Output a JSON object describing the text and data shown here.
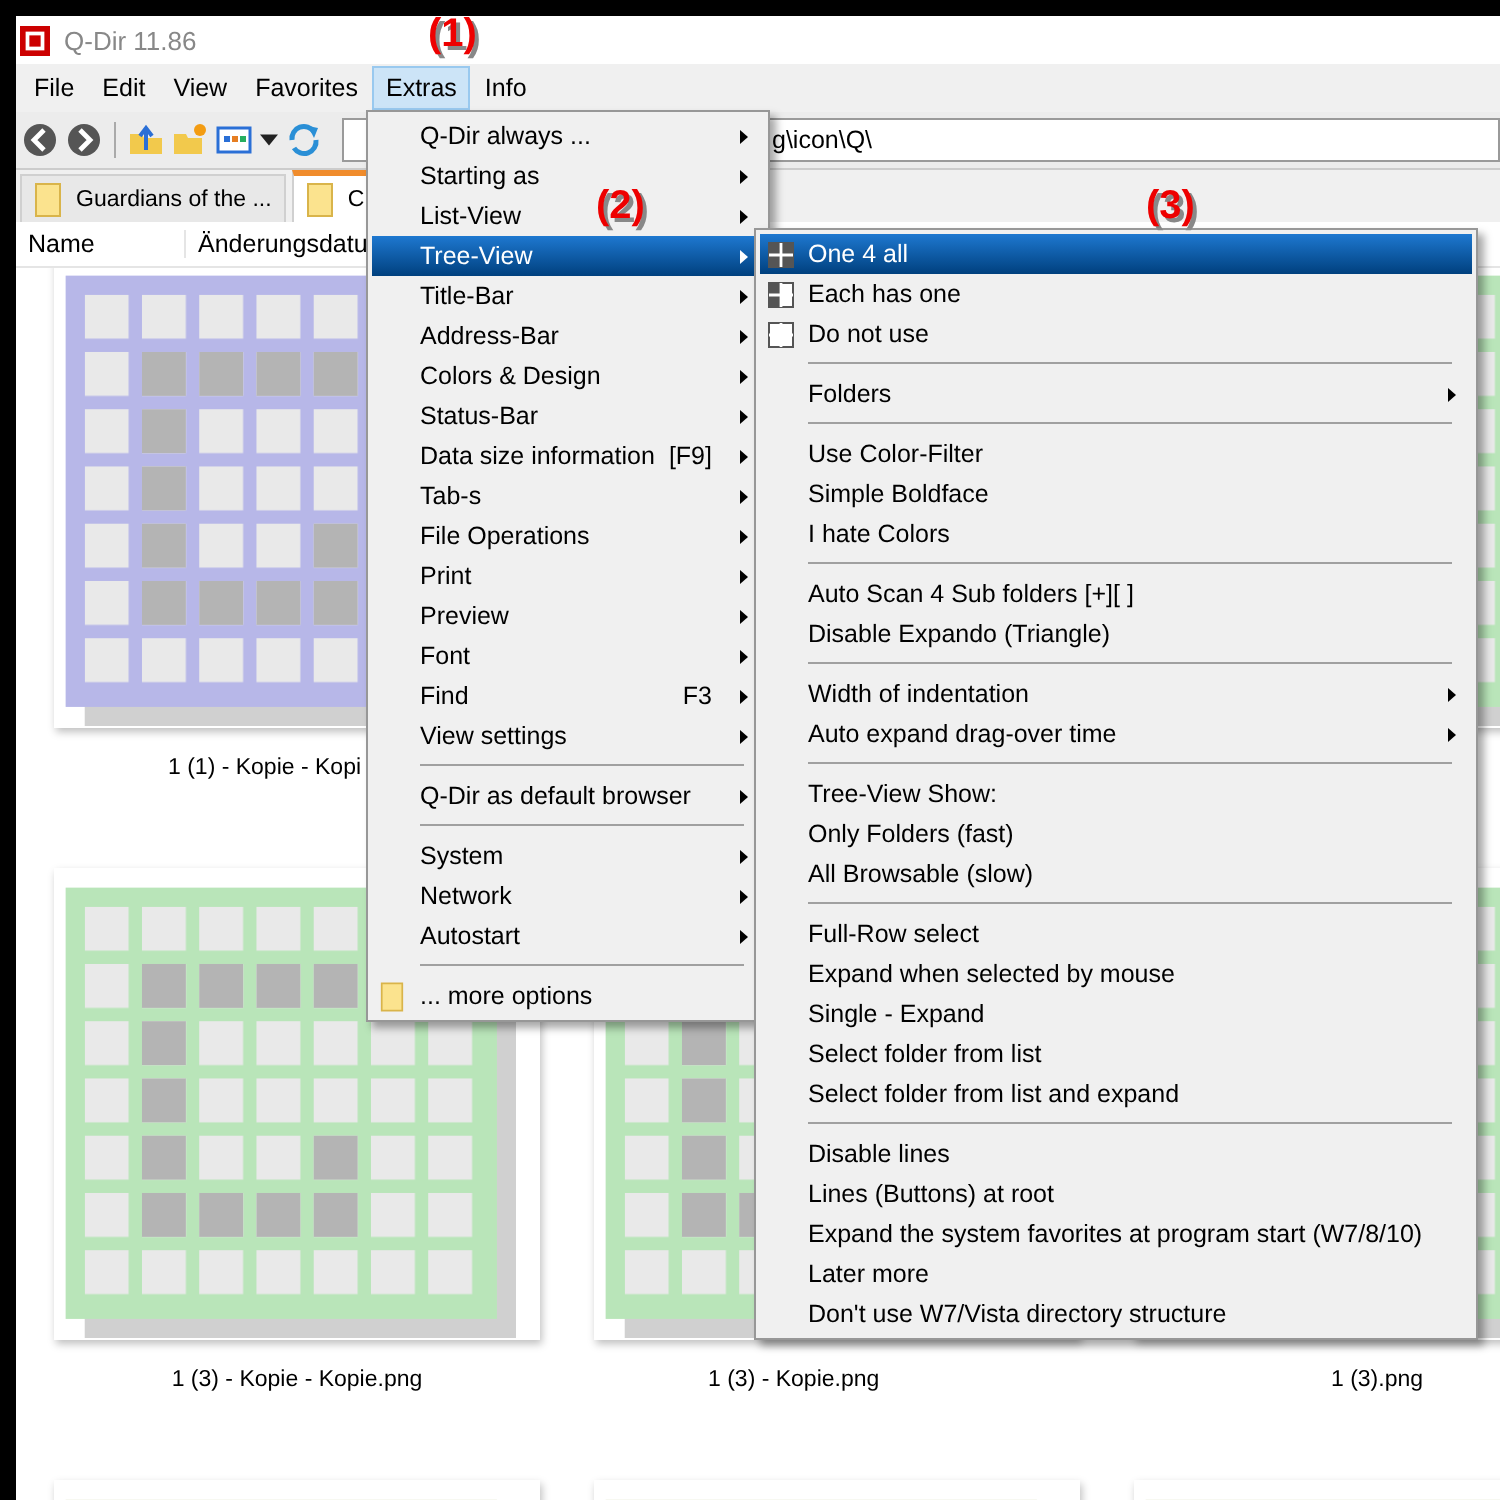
{
  "window": {
    "title": "Q-Dir 11.86"
  },
  "menu_bar": [
    {
      "label": "File",
      "selected": false
    },
    {
      "label": "Edit",
      "selected": false
    },
    {
      "label": "View",
      "selected": false
    },
    {
      "label": "Favorites",
      "selected": false
    },
    {
      "label": "Extras",
      "selected": true
    },
    {
      "label": "Info",
      "selected": false
    }
  ],
  "address_bar": {
    "value": "g\\icon\\Q\\"
  },
  "tabs": [
    {
      "label": "Guardians of the ...",
      "selected": false
    },
    {
      "label": "C",
      "selected": true
    }
  ],
  "columns": [
    "Name",
    "Änderungsdatu"
  ],
  "thumbnails": [
    {
      "kind": "picture",
      "label": "1 (1) - Kopie - Kopi"
    },
    {
      "kind": "picture"
    },
    {
      "kind": "picture",
      "label": "1 (3) - Kopie - Kopie.png"
    },
    {
      "kind": "picture",
      "label": "1 (3) - Kopie.png"
    },
    {
      "kind": "picture",
      "label": "1 (3).png"
    },
    {
      "kind": "picture"
    },
    {
      "kind": "picture"
    },
    {
      "kind": "picture"
    }
  ],
  "extras_menu": [
    {
      "kind": "item",
      "label": "Q-Dir always ...",
      "submenu": true,
      "selected": false
    },
    {
      "kind": "item",
      "label": "Starting as",
      "submenu": true,
      "selected": false
    },
    {
      "kind": "item",
      "label": "List-View",
      "submenu": true,
      "selected": false
    },
    {
      "kind": "item",
      "label": "Tree-View",
      "submenu": true,
      "selected": true
    },
    {
      "kind": "item",
      "label": "Title-Bar",
      "submenu": true,
      "selected": false
    },
    {
      "kind": "item",
      "label": "Address-Bar",
      "submenu": true,
      "selected": false
    },
    {
      "kind": "item",
      "label": "Colors & Design",
      "submenu": true,
      "selected": false
    },
    {
      "kind": "item",
      "label": "Status-Bar",
      "submenu": true,
      "selected": false
    },
    {
      "kind": "item",
      "label": "Data size information",
      "shortcut": "[F9]",
      "submenu": true,
      "selected": false
    },
    {
      "kind": "item",
      "label": "Tab-s",
      "submenu": true,
      "selected": false
    },
    {
      "kind": "item",
      "label": "File Operations",
      "submenu": true,
      "selected": false
    },
    {
      "kind": "item",
      "label": "Print",
      "submenu": true,
      "selected": false
    },
    {
      "kind": "item",
      "label": "Preview",
      "submenu": true,
      "selected": false
    },
    {
      "kind": "item",
      "label": "Font",
      "submenu": true,
      "selected": false
    },
    {
      "kind": "item",
      "label": "Find",
      "shortcut": "F3",
      "submenu": true,
      "selected": false
    },
    {
      "kind": "item",
      "label": "View settings",
      "submenu": true,
      "selected": false
    },
    {
      "kind": "separator"
    },
    {
      "kind": "item",
      "label": "Q-Dir as default browser",
      "submenu": true,
      "selected": false
    },
    {
      "kind": "separator"
    },
    {
      "kind": "item",
      "label": "System",
      "submenu": true,
      "selected": false
    },
    {
      "kind": "item",
      "label": "Network",
      "submenu": true,
      "selected": false
    },
    {
      "kind": "item",
      "label": "Autostart",
      "submenu": true,
      "selected": false
    },
    {
      "kind": "separator"
    },
    {
      "kind": "folder",
      "label": "... more options",
      "submenu": false,
      "selected": false
    }
  ],
  "tree_view_menu": [
    {
      "kind": "gridfull",
      "label": "One 4 all",
      "submenu": false,
      "selected": true
    },
    {
      "kind": "gridhalf",
      "label": "Each has one",
      "submenu": false,
      "selected": false
    },
    {
      "kind": "gridempty",
      "label": "Do not use",
      "submenu": false,
      "selected": false
    },
    {
      "kind": "separator"
    },
    {
      "kind": "item",
      "label": "Folders",
      "submenu": true,
      "selected": false
    },
    {
      "kind": "separator"
    },
    {
      "kind": "item",
      "label": "Use Color-Filter",
      "submenu": false,
      "selected": false
    },
    {
      "kind": "item",
      "label": "Simple Boldface",
      "submenu": false,
      "selected": false
    },
    {
      "kind": "item",
      "label": "I hate Colors",
      "submenu": false,
      "selected": false
    },
    {
      "kind": "separator"
    },
    {
      "kind": "item",
      "label": "Auto Scan 4 Sub folders  [+][ ]",
      "submenu": false,
      "selected": false
    },
    {
      "kind": "item",
      "label": "Disable Expando (Triangle)",
      "submenu": false,
      "selected": false
    },
    {
      "kind": "separator"
    },
    {
      "kind": "item",
      "label": "Width of indentation",
      "submenu": true,
      "selected": false
    },
    {
      "kind": "item",
      "label": "Auto expand drag-over time",
      "submenu": true,
      "selected": false
    },
    {
      "kind": "separator"
    },
    {
      "kind": "item",
      "label": "Tree-View Show:",
      "submenu": false,
      "selected": false
    },
    {
      "kind": "item",
      "label": "Only Folders (fast)",
      "submenu": false,
      "selected": false
    },
    {
      "kind": "item",
      "label": "All Browsable (slow)",
      "submenu": false,
      "selected": false
    },
    {
      "kind": "separator"
    },
    {
      "kind": "item",
      "label": "Full-Row select",
      "submenu": false,
      "selected": false
    },
    {
      "kind": "item",
      "label": "Expand when selected by mouse",
      "submenu": false,
      "selected": false
    },
    {
      "kind": "item",
      "label": "Single - Expand",
      "submenu": false,
      "selected": false
    },
    {
      "kind": "item",
      "label": "Select folder from list",
      "submenu": false,
      "selected": false
    },
    {
      "kind": "item",
      "label": "Select folder from list and expand",
      "submenu": false,
      "selected": false
    },
    {
      "kind": "separator"
    },
    {
      "kind": "item",
      "label": "Disable lines",
      "submenu": false,
      "selected": false
    },
    {
      "kind": "item",
      "label": "Lines (Buttons) at root",
      "submenu": false,
      "selected": false
    },
    {
      "kind": "item",
      "label": "Expand the system favorites at program start (W7/8/10)",
      "submenu": false,
      "selected": false
    },
    {
      "kind": "item",
      "label": "Later more",
      "submenu": false,
      "selected": false
    },
    {
      "kind": "item",
      "label": "Don't use W7/Vista directory structure",
      "submenu": false,
      "selected": false
    }
  ],
  "annotations": [
    "(1)",
    "(2)",
    "(3)"
  ]
}
